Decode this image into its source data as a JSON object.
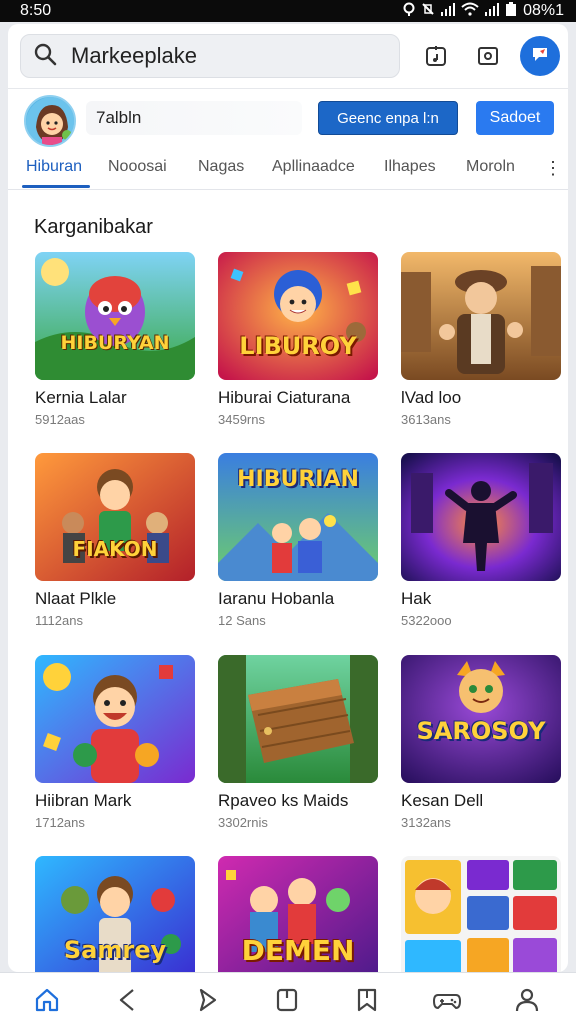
{
  "status_bar": {
    "time": "8:50",
    "battery": "08%1"
  },
  "search": {
    "value": "Markeeplake"
  },
  "user": {
    "name": "7albln"
  },
  "actions": {
    "outline_label": "Geenc enpa l:n",
    "primary_label": "Sadoet"
  },
  "tabs": [
    "Hiburan",
    "Nooosai",
    "Nagas",
    "Apllinaadce",
    "Ilhapes",
    "Moroln"
  ],
  "section": {
    "title": "Karganibakar"
  },
  "tiles": [
    {
      "title": "Kernia Lalar",
      "subtitle": "5912aas",
      "art_text": "HIBURYAN"
    },
    {
      "title": "Hiburai Ciaturana",
      "subtitle": "3459rns",
      "art_text": "LIBUROY"
    },
    {
      "title": "lVad loo",
      "subtitle": "3613ans",
      "art_text": ""
    },
    {
      "title": "Nlaat Plkle",
      "subtitle": "1112ans",
      "art_text": "FIAKON"
    },
    {
      "title": "Iaranu Hobanla",
      "subtitle": "12 Sans",
      "art_text": "HIBURIAN"
    },
    {
      "title": "Hak",
      "subtitle": "5322ooo",
      "art_text": ""
    },
    {
      "title": "Hiibran Mark",
      "subtitle": "1712ans",
      "art_text": ""
    },
    {
      "title": "Rpaveo ks Maids",
      "subtitle": "3302rnis",
      "art_text": ""
    },
    {
      "title": "Kesan Dell",
      "subtitle": "3132ans",
      "art_text": "SAROSOY"
    },
    {
      "title": "",
      "subtitle": "",
      "art_text": "Samrey"
    },
    {
      "title": "",
      "subtitle": "",
      "art_text": "DEMEN"
    },
    {
      "title": "",
      "subtitle": "",
      "art_text": ""
    }
  ]
}
